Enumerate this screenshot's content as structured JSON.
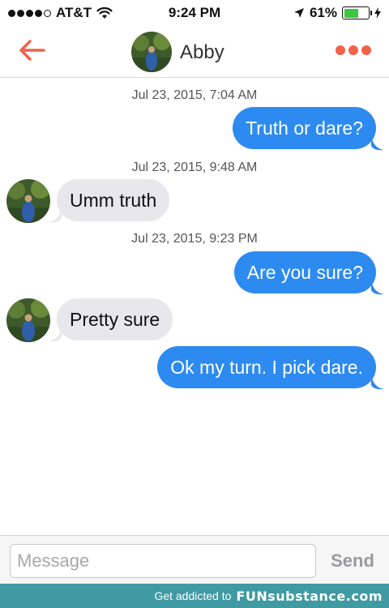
{
  "status_bar": {
    "carrier": "AT&T",
    "time": "9:24 PM",
    "battery_percent_label": "61%",
    "battery_level": 0.61,
    "signal_bars": 4,
    "signal_total": 5
  },
  "header": {
    "contact_name": "Abby",
    "accent_color": "#f0624a"
  },
  "messages": [
    {
      "type": "timestamp",
      "text": "Jul 23, 2015, 7:04 AM"
    },
    {
      "type": "outgoing",
      "text": "Truth or dare?"
    },
    {
      "type": "timestamp",
      "text": "Jul 23, 2015, 9:48 AM"
    },
    {
      "type": "incoming",
      "text": "Umm truth"
    },
    {
      "type": "timestamp",
      "text": "Jul 23, 2015, 9:23 PM"
    },
    {
      "type": "outgoing",
      "text": "Are you sure?"
    },
    {
      "type": "incoming",
      "text": "Pretty sure"
    },
    {
      "type": "outgoing",
      "text": "Ok my turn. I pick dare."
    }
  ],
  "composer": {
    "placeholder": "Message",
    "send_label": "Send"
  },
  "banner": {
    "tagline": "Get addicted to",
    "brand": "FUNsubstance.com"
  },
  "colors": {
    "outgoing_bubble": "#2d8af0",
    "incoming_bubble": "#e7e7ec",
    "banner": "#3f9aa2"
  }
}
